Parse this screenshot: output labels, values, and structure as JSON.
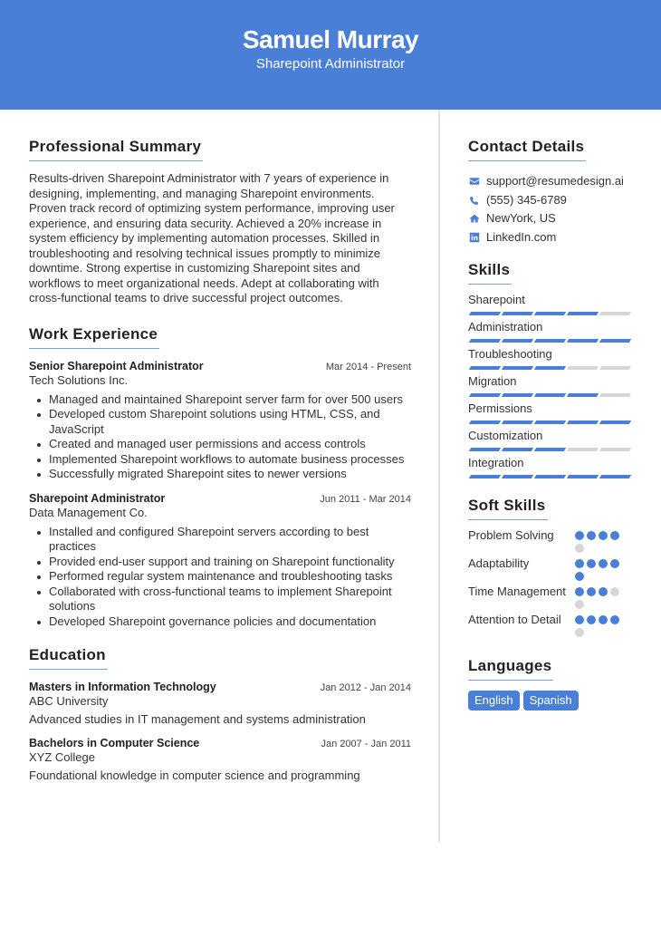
{
  "header": {
    "name": "Samuel Murray",
    "role": "Sharepoint Administrator"
  },
  "colors": {
    "accent": "#4a7fd8",
    "inactive": "#d6d6d6"
  },
  "summary": {
    "title": "Professional Summary",
    "text": "Results-driven Sharepoint Administrator with 7 years of experience in designing, implementing, and managing Sharepoint environments. Proven track record of optimizing system performance, improving user experience, and ensuring data security. Achieved a 20% increase in system efficiency by implementing automation processes. Skilled in troubleshooting and resolving technical issues promptly to minimize downtime. Strong expertise in customizing Sharepoint sites and workflows to meet organizational needs. Adept at collaborating with cross-functional teams to drive successful project outcomes."
  },
  "work": {
    "title": "Work Experience",
    "jobs": [
      {
        "title": "Senior Sharepoint Administrator",
        "date": "Mar 2014 - Present",
        "company": "Tech Solutions Inc.",
        "bullets": [
          "Managed and maintained Sharepoint server farm for over 500 users",
          "Developed custom Sharepoint solutions using HTML, CSS, and JavaScript",
          "Created and managed user permissions and access controls",
          "Implemented Sharepoint workflows to automate business processes",
          "Successfully migrated Sharepoint sites to newer versions"
        ]
      },
      {
        "title": "Sharepoint Administrator",
        "date": "Jun 2011 - Mar 2014",
        "company": "Data Management Co.",
        "bullets": [
          "Installed and configured Sharepoint servers according to best practices",
          "Provided end-user support and training on Sharepoint functionality",
          "Performed regular system maintenance and troubleshooting tasks",
          "Collaborated with cross-functional teams to implement Sharepoint solutions",
          "Developed Sharepoint governance policies and documentation"
        ]
      }
    ]
  },
  "education": {
    "title": "Education",
    "items": [
      {
        "degree": "Masters in Information Technology",
        "date": "Jan 2012 - Jan 2014",
        "school": "ABC University",
        "desc": "Advanced studies in IT management and systems administration"
      },
      {
        "degree": "Bachelors in Computer Science",
        "date": "Jan 2007 - Jan 2011",
        "school": "XYZ College",
        "desc": "Foundational knowledge in computer science and programming"
      }
    ]
  },
  "contact": {
    "title": "Contact Details",
    "items": [
      {
        "icon": "envelope-icon",
        "text": "support@resumedesign.ai"
      },
      {
        "icon": "phone-icon",
        "text": "(555) 345-6789"
      },
      {
        "icon": "home-icon",
        "text": "NewYork, US"
      },
      {
        "icon": "linkedin-icon",
        "text": "LinkedIn.com"
      }
    ]
  },
  "skills": {
    "title": "Skills",
    "max": 5,
    "items": [
      {
        "name": "Sharepoint",
        "level": 4
      },
      {
        "name": "Administration",
        "level": 5
      },
      {
        "name": "Troubleshooting",
        "level": 3
      },
      {
        "name": "Migration",
        "level": 4
      },
      {
        "name": "Permissions",
        "level": 5
      },
      {
        "name": "Customization",
        "level": 3
      },
      {
        "name": "Integration",
        "level": 5
      }
    ]
  },
  "soft_skills": {
    "title": "Soft Skills",
    "max": 5,
    "items": [
      {
        "name": "Problem Solving",
        "level": 4
      },
      {
        "name": "Adaptability",
        "level": 5
      },
      {
        "name": "Time Management",
        "level": 3
      },
      {
        "name": "Attention to Detail",
        "level": 4
      }
    ]
  },
  "languages": {
    "title": "Languages",
    "items": [
      "English",
      "Spanish"
    ]
  }
}
